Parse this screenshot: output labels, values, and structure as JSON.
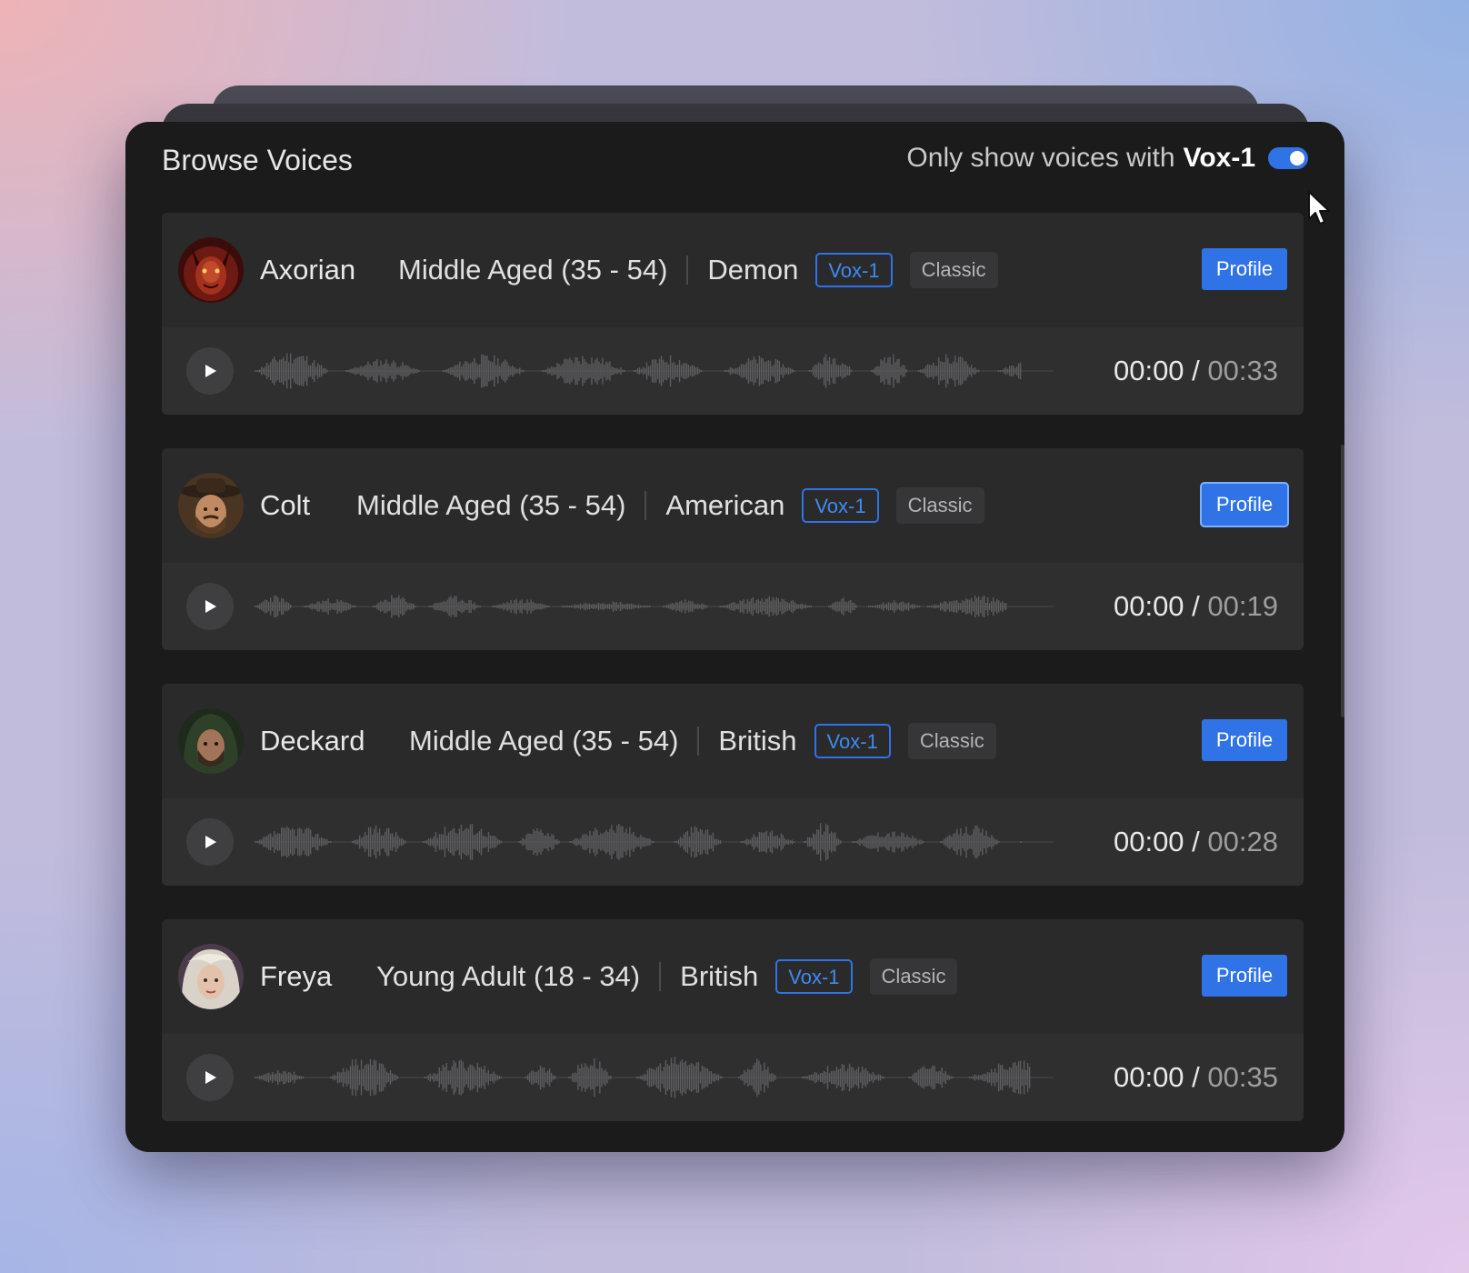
{
  "header": {
    "title": "Browse Voices",
    "filter_label": "Only show voices with",
    "filter_model": "Vox-1",
    "filter_enabled": true
  },
  "voices": [
    {
      "name": "Axorian",
      "age": "Middle Aged (35 - 54)",
      "accent": "Demon",
      "model_tag": "Vox-1",
      "style_tag": "Classic",
      "profile_label": "Profile",
      "time_current": "00:00",
      "time_separator": "/",
      "time_total": "00:33",
      "avatar_icon": "demon-avatar"
    },
    {
      "name": "Colt",
      "age": "Middle Aged (35 - 54)",
      "accent": "American",
      "model_tag": "Vox-1",
      "style_tag": "Classic",
      "profile_label": "Profile",
      "time_current": "00:00",
      "time_separator": "/",
      "time_total": "00:19",
      "avatar_icon": "cowboy-avatar"
    },
    {
      "name": "Deckard",
      "age": "Middle Aged (35 - 54)",
      "accent": "British",
      "model_tag": "Vox-1",
      "style_tag": "Classic",
      "profile_label": "Profile",
      "time_current": "00:00",
      "time_separator": "/",
      "time_total": "00:28",
      "avatar_icon": "hooded-man-avatar"
    },
    {
      "name": "Freya",
      "age": "Young Adult (18 - 34)",
      "accent": "British",
      "model_tag": "Vox-1",
      "style_tag": "Classic",
      "profile_label": "Profile",
      "time_current": "00:00",
      "time_separator": "/",
      "time_total": "00:35",
      "avatar_icon": "elf-woman-avatar"
    }
  ],
  "colors": {
    "accent": "#2f73e6",
    "window_bg": "#1b1b1c",
    "card_bg": "#2a2a2b",
    "player_bg": "#2f2f30"
  }
}
